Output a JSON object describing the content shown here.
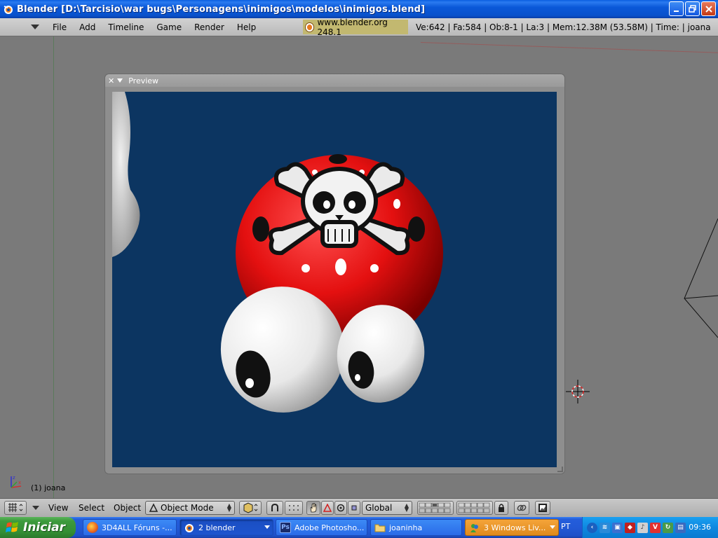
{
  "window": {
    "title": "Blender [D:\\Tarcisio\\war bugs\\Personagens\\inimigos\\modelos\\inimigos.blend]",
    "buttons": {
      "minimize": "_",
      "maximize": "❐",
      "close": "✕"
    }
  },
  "menubar": {
    "items": [
      "File",
      "Add",
      "Timeline",
      "Game",
      "Render",
      "Help"
    ],
    "link": "www.blender.org 248.1",
    "stats": "Ve:642 | Fa:584 | Ob:8-1 | La:3  | Mem:12.38M (53.58M)  | Time: | joana"
  },
  "preview": {
    "label": "Preview",
    "close": "✕"
  },
  "viewport": {
    "object_label": "(1) joana"
  },
  "headerbar": {
    "menus": [
      "View",
      "Select",
      "Object"
    ],
    "mode": "Object Mode",
    "orientation": "Global"
  },
  "taskbar": {
    "start_label": "Iniciar",
    "tasks": [
      {
        "label": "3D4ALL Fóruns -...",
        "icon": "firefox-icon"
      },
      {
        "label": "2 blender",
        "icon": "blender-icon"
      },
      {
        "label": "Adobe Photosho...",
        "icon": "photoshop-icon"
      },
      {
        "label": "joaninha",
        "icon": "folder-icon"
      },
      {
        "label": "3 Windows Liv...",
        "icon": "windows-live-icon"
      }
    ],
    "language": "PT",
    "clock": "09:36"
  },
  "colors": {
    "render_bg": "#0c3561",
    "ladybug_red": "#e01010",
    "viewport_bg": "#7a7a7a"
  }
}
